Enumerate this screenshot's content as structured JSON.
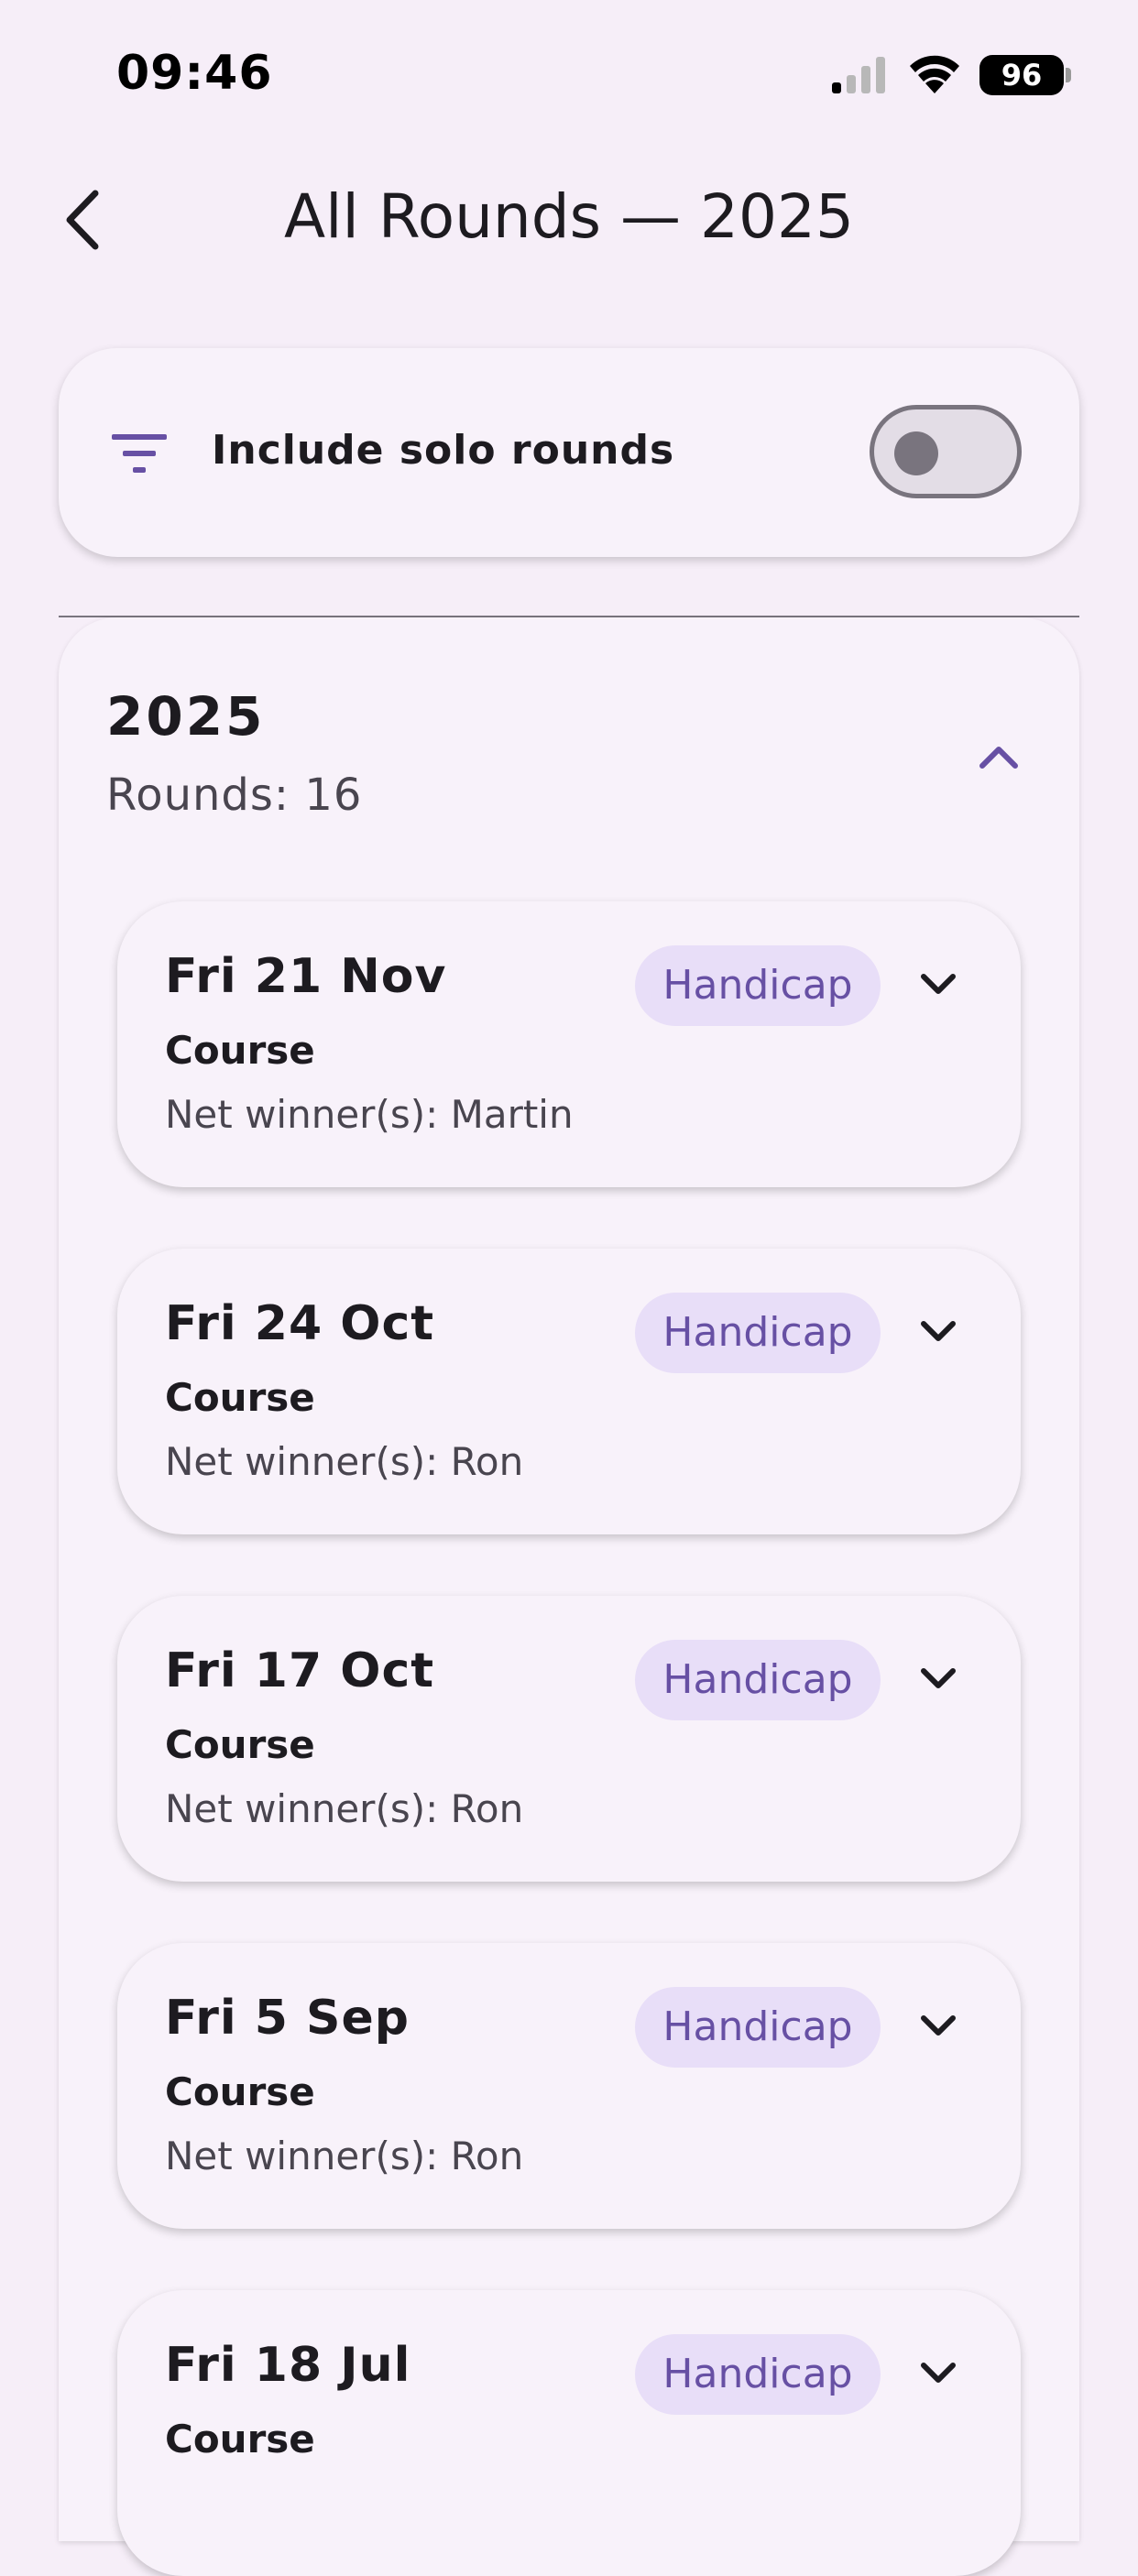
{
  "status_bar": {
    "time": "09:46",
    "battery": "96",
    "signal_icon": "cellular-signal-icon",
    "wifi_icon": "wifi-icon"
  },
  "header": {
    "title": "All Rounds — 2025",
    "back_icon": "chevron-left-icon"
  },
  "filter": {
    "icon": "filter-icon",
    "label": "Include solo rounds",
    "toggle_on": false
  },
  "year_section": {
    "year": "2025",
    "rounds_count_label": "Rounds: 16",
    "collapse_icon": "chevron-up-icon",
    "rounds": [
      {
        "date": "Fri 21 Nov",
        "course": "Course",
        "winner": "Net winner(s): Martin",
        "badge": "Handicap"
      },
      {
        "date": "Fri 24 Oct",
        "course": "Course",
        "winner": "Net winner(s): Ron",
        "badge": "Handicap"
      },
      {
        "date": "Fri 17 Oct",
        "course": "Course",
        "winner": "Net winner(s): Ron",
        "badge": "Handicap"
      },
      {
        "date": "Fri 5 Sep",
        "course": "Course",
        "winner": "Net winner(s): Ron",
        "badge": "Handicap"
      },
      {
        "date": "Fri 18 Jul",
        "course": "Course",
        "winner": "",
        "badge": "Handicap"
      }
    ]
  },
  "colors": {
    "background": "#f6eef8",
    "surface": "#f8f2fa",
    "primary": "#6750a4",
    "badge_bg": "#e8def8"
  }
}
